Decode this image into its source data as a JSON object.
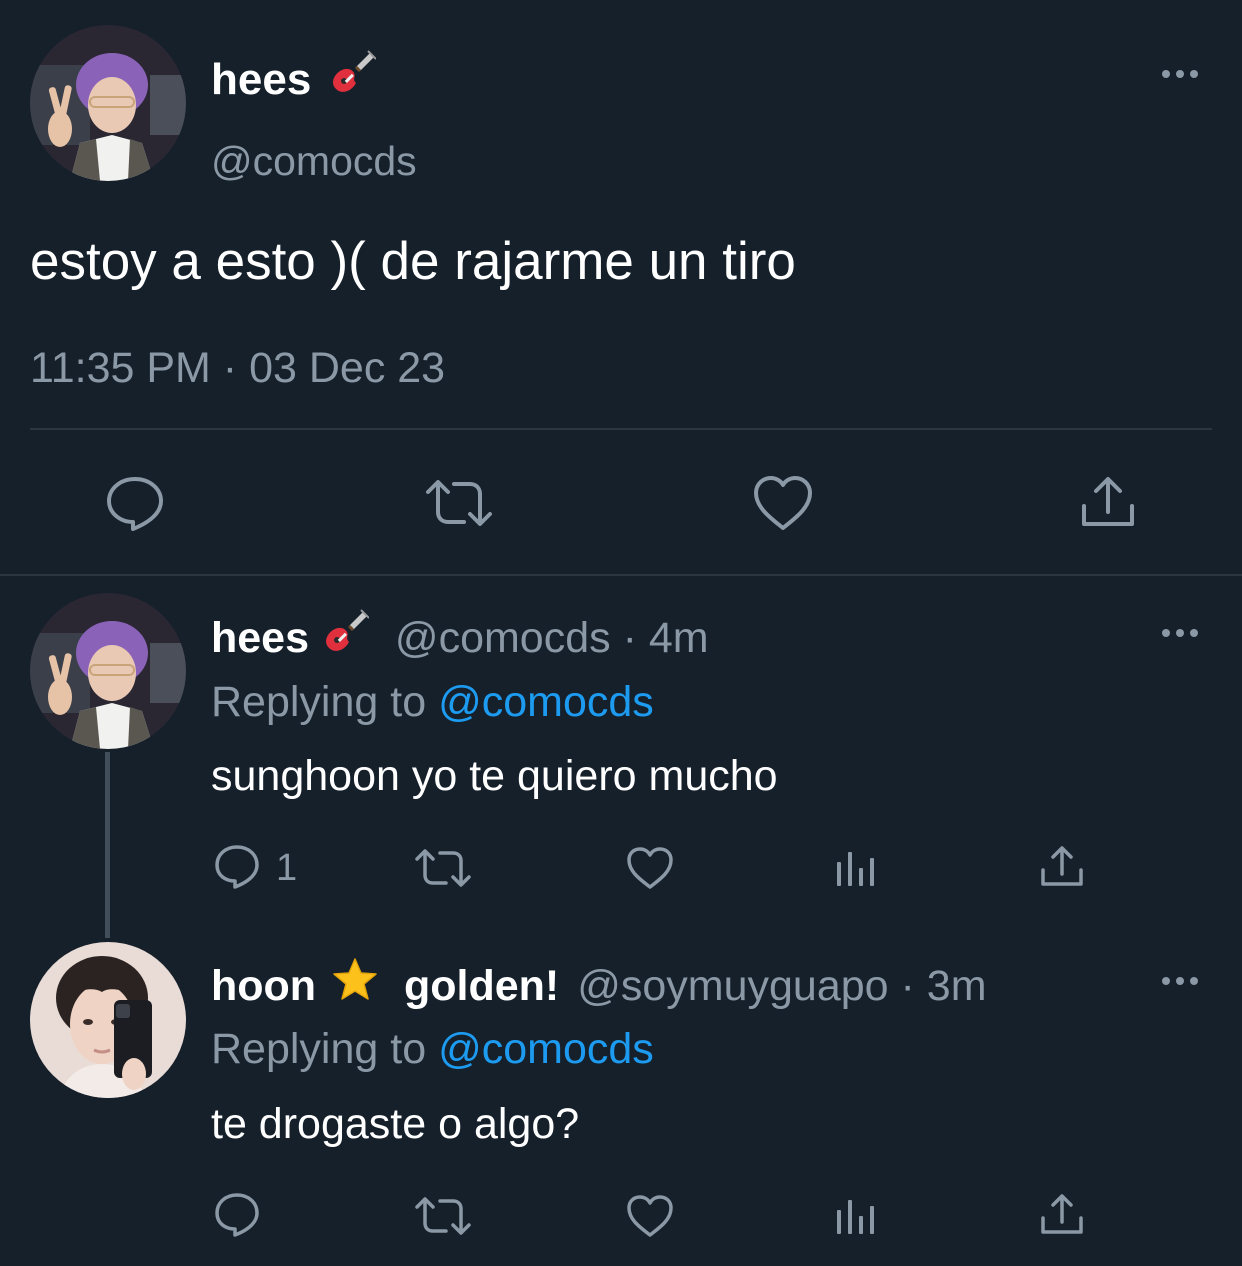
{
  "main_tweet": {
    "display_name": "hees",
    "name_emoji": "guitar-emoji",
    "handle": "@comocds",
    "text": "estoy a esto )( de rajarme un tiro",
    "timestamp": "11:35 PM · 03 Dec 23",
    "actions": [
      "reply-icon",
      "retweet-icon",
      "like-icon",
      "share-icon"
    ]
  },
  "replies": [
    {
      "display_name": "hees",
      "name_emoji": "guitar-emoji",
      "handle": "@comocds",
      "time": "· 4m",
      "replying_label": "Replying to",
      "replying_handle": "@comocds",
      "text": "sunghoon yo te quiero mucho",
      "reply_count": "1"
    },
    {
      "display_name": "hoon",
      "name_emoji": "star-emoji",
      "name_suffix": "golden!",
      "handle": "@soymuyguapo",
      "time": "· 3m",
      "replying_label": "Replying to",
      "replying_handle": "@comocds",
      "text": "te drogaste o algo?",
      "reply_count": ""
    }
  ],
  "colors": {
    "background": "#15202b",
    "text": "#ffffff",
    "muted": "#8b98a5",
    "link": "#1d9bf0",
    "divider": "#2c3640"
  }
}
